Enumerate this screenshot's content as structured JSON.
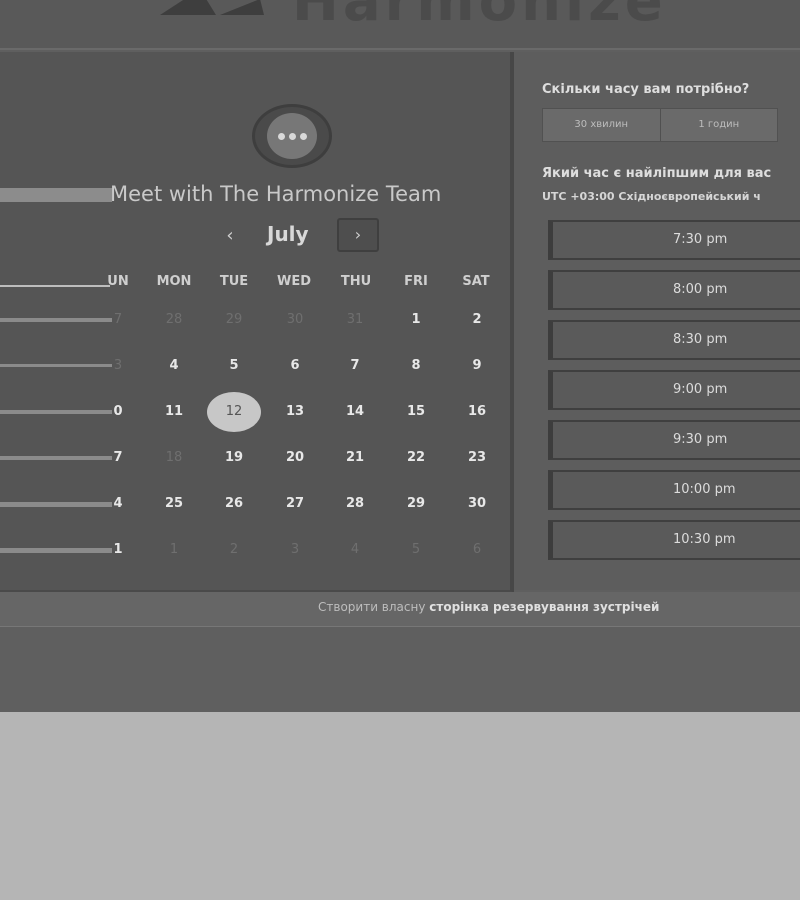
{
  "header": {
    "brand": "Harmonize"
  },
  "calendar": {
    "title": "Meet with The Harmonize Team",
    "month": "July",
    "prev_label": "‹",
    "next_label": "›",
    "weekdays": [
      "UN",
      "MON",
      "TUE",
      "WED",
      "THU",
      "FRI",
      "SAT"
    ],
    "weeks": [
      [
        "7",
        "28",
        "29",
        "30",
        "31",
        "1",
        "2"
      ],
      [
        "3",
        "4",
        "5",
        "6",
        "7",
        "8",
        "9"
      ],
      [
        "0",
        "11",
        "12",
        "13",
        "14",
        "15",
        "16"
      ],
      [
        "7",
        "18",
        "19",
        "20",
        "21",
        "22",
        "23"
      ],
      [
        "4",
        "25",
        "26",
        "27",
        "28",
        "29",
        "30"
      ],
      [
        "1",
        "1",
        "2",
        "3",
        "4",
        "5",
        "6"
      ]
    ],
    "selected_day": "12"
  },
  "booking": {
    "duration_question": "Скільки часу вам потрібно?",
    "durations": [
      "30 хвилин",
      "1 годин"
    ],
    "time_question": "Який час є найліпшим для вас",
    "timezone": "UTC +03:00 Східноєвропейський ч",
    "slots": [
      "7:30 pm",
      "8:00 pm",
      "8:30 pm",
      "9:00 pm",
      "9:30 pm",
      "10:00 pm",
      "10:30 pm"
    ]
  },
  "footer": {
    "prefix": "Створити власну",
    "link": "сторінка резервування зустрічей"
  }
}
